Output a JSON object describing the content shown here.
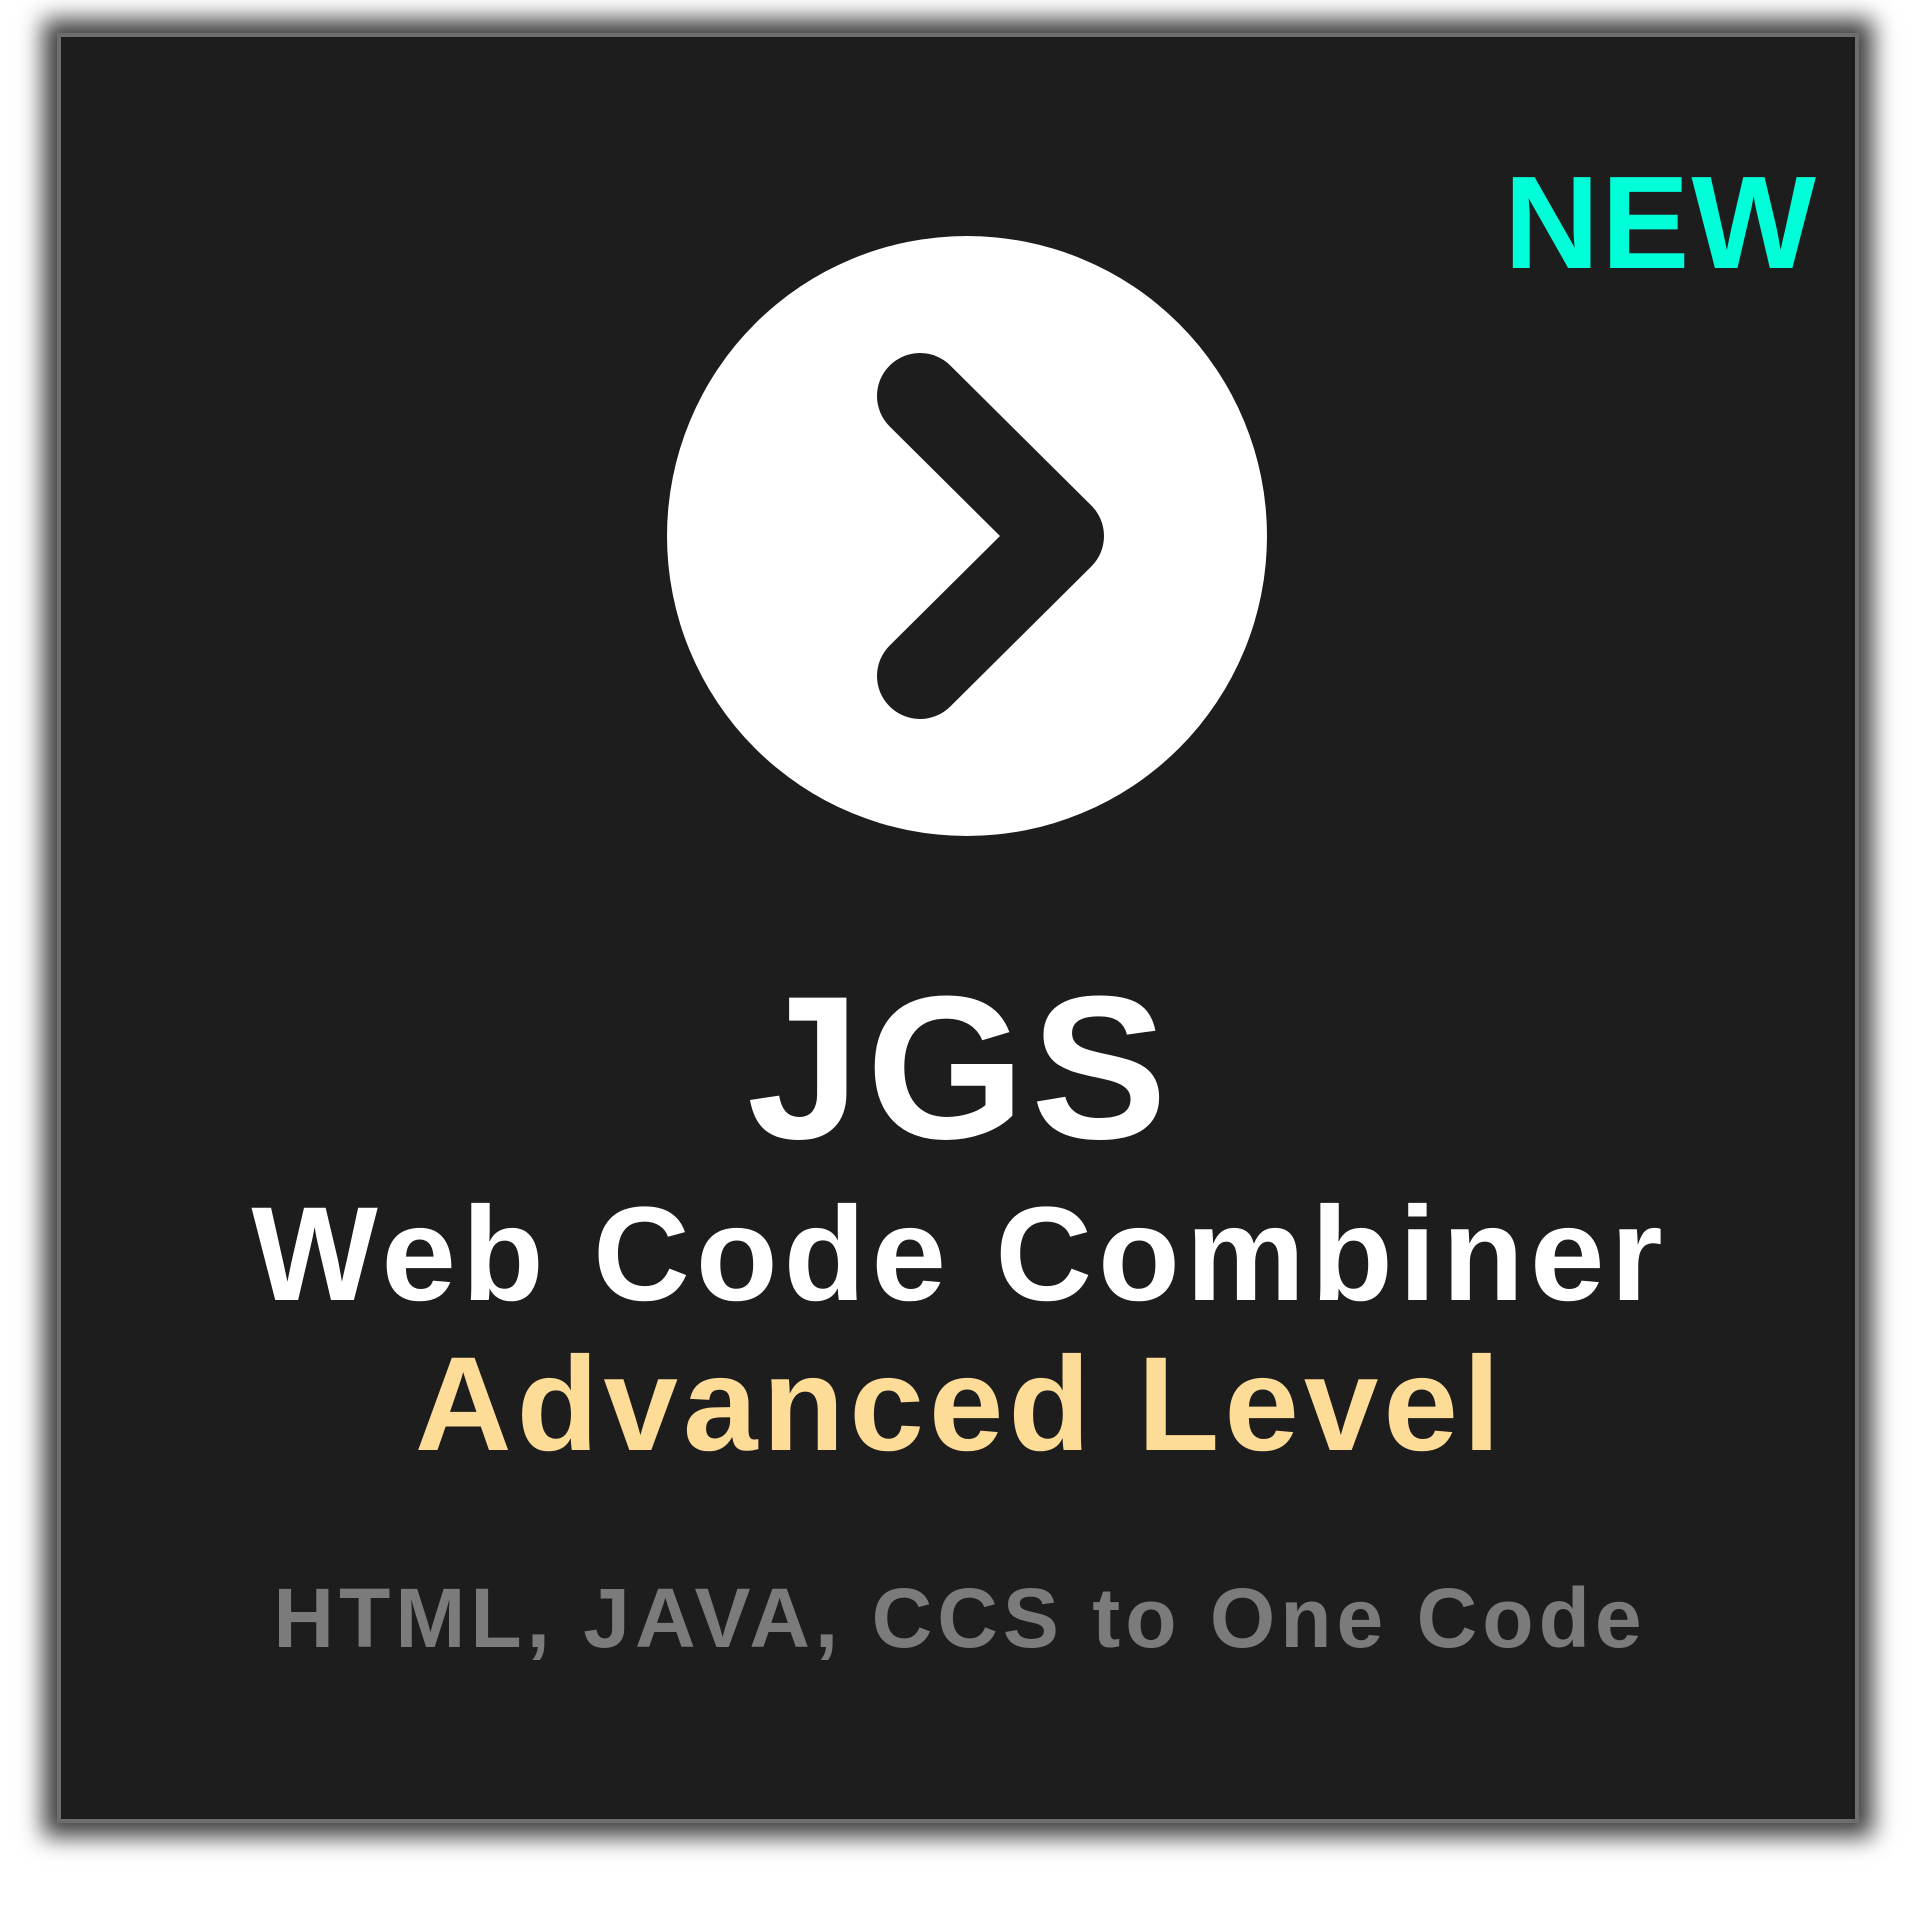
{
  "badge": {
    "label": "NEW",
    "color": "#00ffd8"
  },
  "logo": {
    "icon": "chevron-right-in-circle-icon",
    "circle_color": "#ffffff",
    "chevron_color": "#1d1d1d"
  },
  "title": {
    "brand": "JGS",
    "product": "Web Code Combiner",
    "level": "Advanced Level"
  },
  "tagline": "HTML, JAVA, CCS to One Code",
  "colors": {
    "background": "#1d1d1d",
    "primary_text": "#ffffff",
    "level_text": "#fddc98",
    "tagline_text": "#7b7b7b",
    "border": "#6e6e6e"
  }
}
